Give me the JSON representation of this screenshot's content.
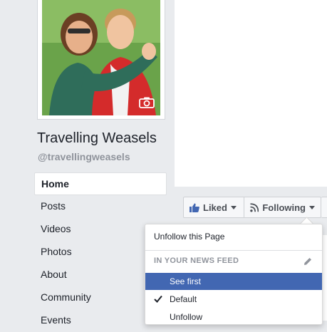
{
  "page": {
    "name": "Travelling Weasels",
    "handle": "@travellingweasels"
  },
  "nav": {
    "items": [
      {
        "label": "Home",
        "active": true
      },
      {
        "label": "Posts"
      },
      {
        "label": "Videos"
      },
      {
        "label": "Photos"
      },
      {
        "label": "About"
      },
      {
        "label": "Community"
      },
      {
        "label": "Events"
      }
    ]
  },
  "actions": {
    "liked_label": "Liked",
    "following_label": "Following"
  },
  "dropdown": {
    "unfollow_page": "Unfollow this Page",
    "section_header": "IN YOUR NEWS FEED",
    "options": [
      {
        "label": "See first",
        "highlighted": true
      },
      {
        "label": "Default",
        "checked": true
      },
      {
        "label": "Unfollow"
      }
    ]
  },
  "colors": {
    "accent": "#4267b2",
    "background": "#e9ebee"
  },
  "icons": {
    "liked": "thumbs-up-icon",
    "following": "rss-icon",
    "edit": "pencil-icon",
    "selected": "check-icon",
    "photo": "camera-icon"
  }
}
